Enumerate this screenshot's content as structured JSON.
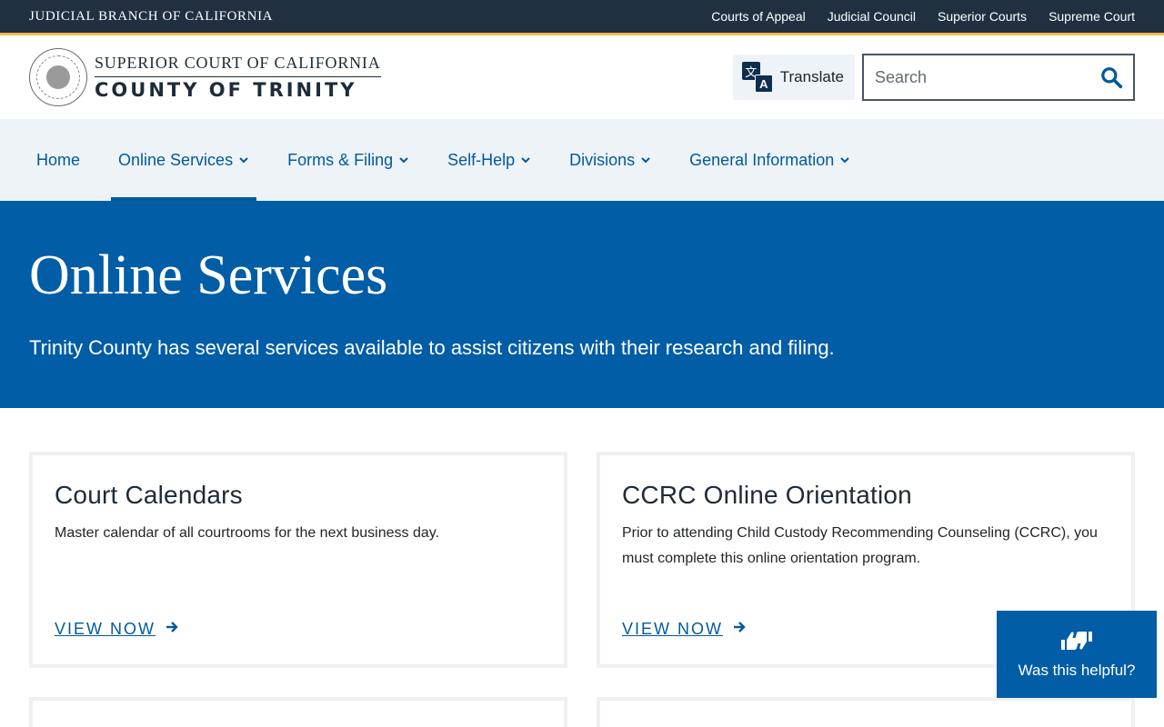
{
  "topbar": {
    "branch": "JUDICIAL BRANCH OF CALIFORNIA",
    "links": [
      "Courts of Appeal",
      "Judicial Council",
      "Superior Courts",
      "Supreme Court"
    ]
  },
  "header": {
    "brand_top": "SUPERIOR COURT OF CALIFORNIA",
    "brand_bottom": "COUNTY OF TRINITY",
    "translate_label": "Translate",
    "search_placeholder": "Search"
  },
  "nav": {
    "items": [
      {
        "label": "Home",
        "dropdown": false
      },
      {
        "label": "Online Services",
        "dropdown": true,
        "active": true
      },
      {
        "label": "Forms & Filing",
        "dropdown": true
      },
      {
        "label": "Self-Help",
        "dropdown": true
      },
      {
        "label": "Divisions",
        "dropdown": true
      },
      {
        "label": "General Information",
        "dropdown": true
      }
    ]
  },
  "hero": {
    "title": "Online Services",
    "subtitle": "Trinity County has several services available to assist citizens with their research and filing."
  },
  "cards": [
    {
      "title": "Court Calendars",
      "description": "Master calendar of all courtrooms for the next business day.",
      "link": "VIEW NOW"
    },
    {
      "title": "CCRC Online Orientation",
      "description": "Prior to attending Child Custody Recommending Counseling (CCRC), you must complete this online orientation program.",
      "link": "VIEW NOW"
    }
  ],
  "feedback": {
    "label": "Was this helpful?"
  },
  "colors": {
    "navy": "#213040",
    "gold": "#f2b84b",
    "brand_blue": "#005da6",
    "nav_bg": "#eef3f8",
    "link_blue": "#005a9a"
  },
  "icons": {
    "translate": "translate-icon",
    "search": "search-icon",
    "chevron": "chevron-down-icon",
    "arrow": "arrow-right-icon",
    "thumbs": "thumbs-up-down-icon"
  }
}
